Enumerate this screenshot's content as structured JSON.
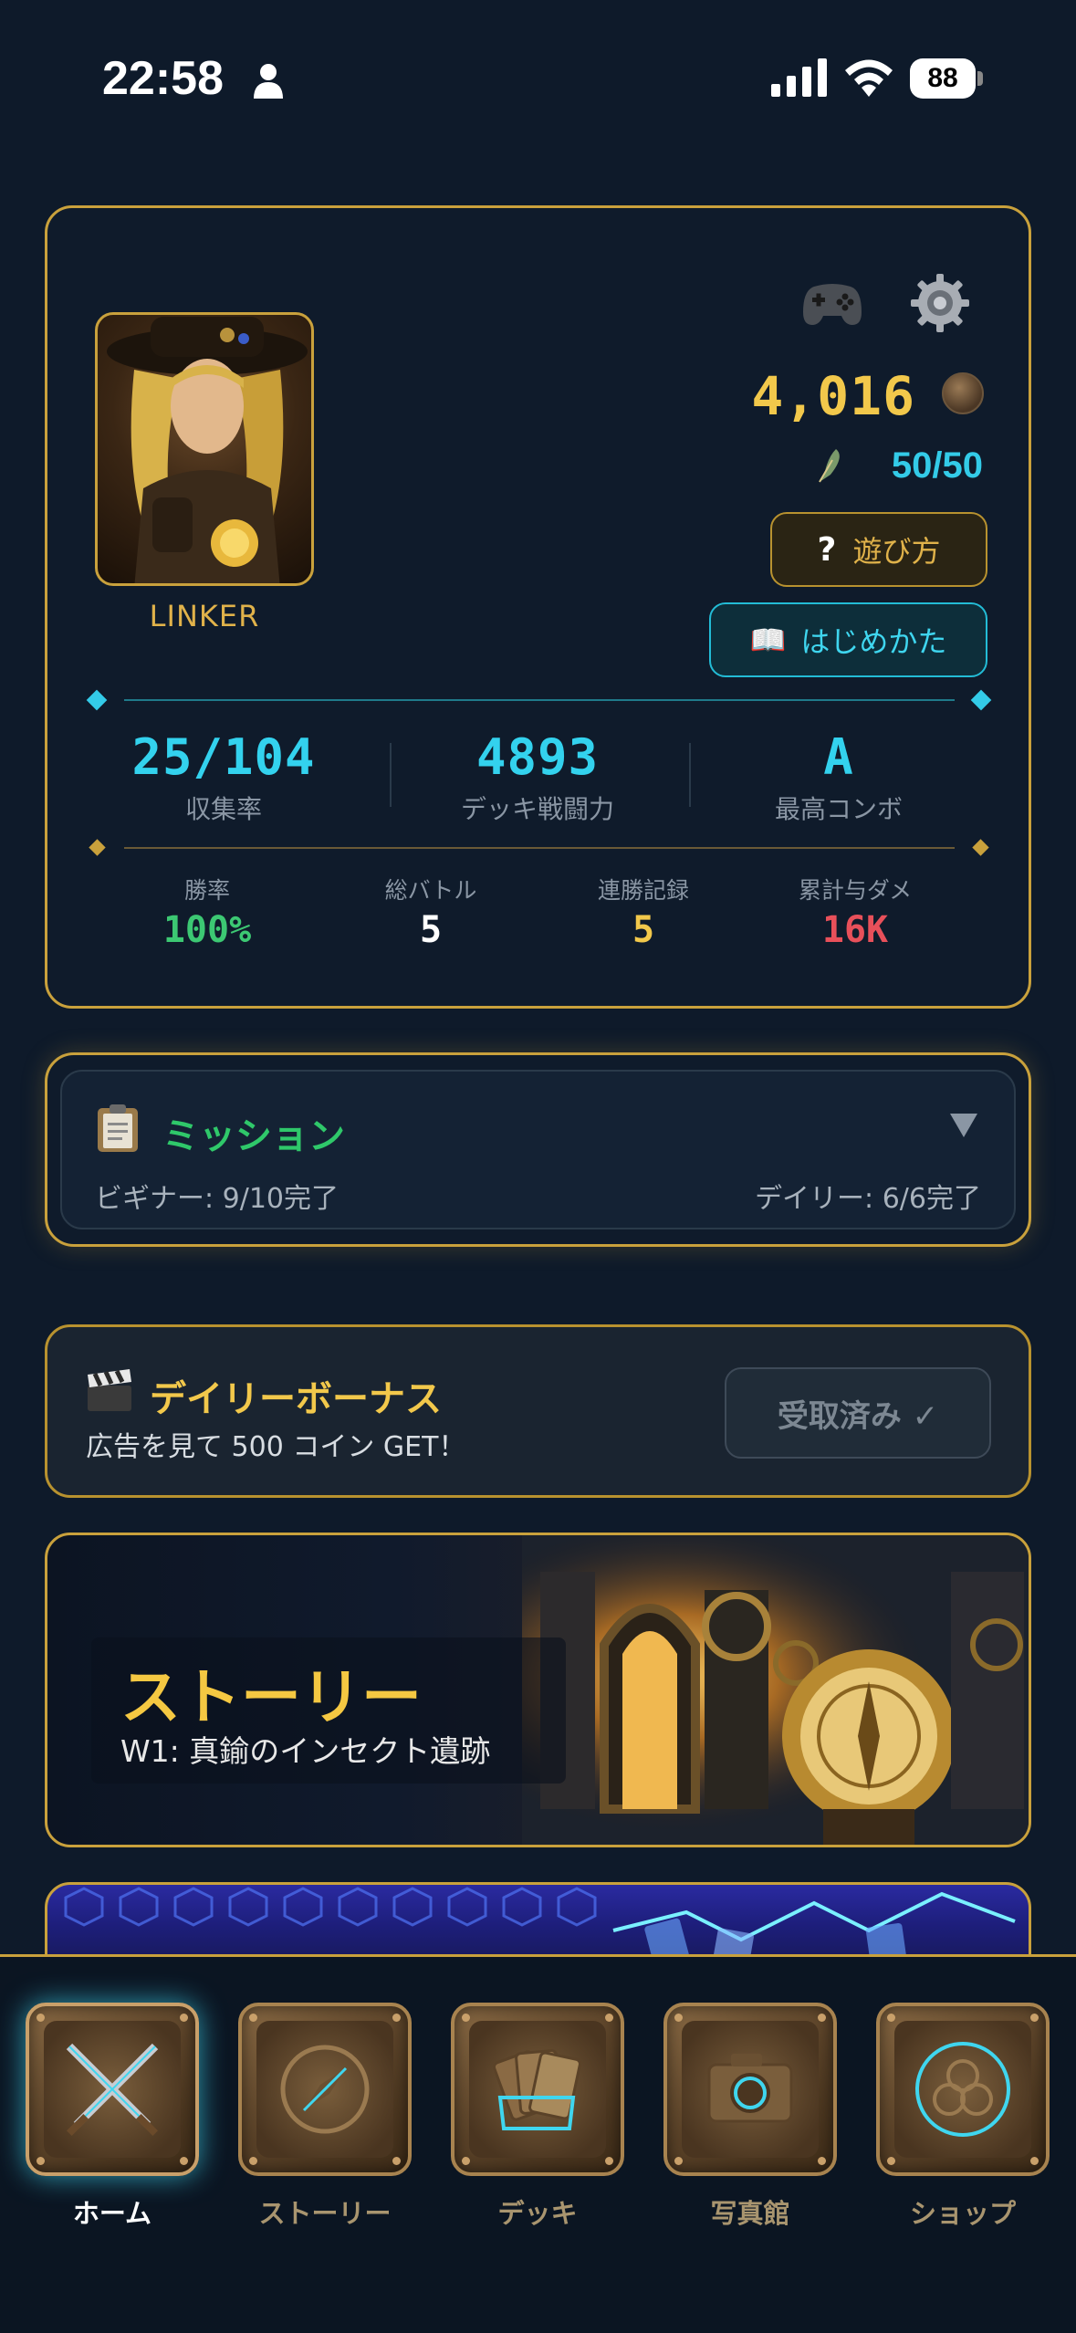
{
  "status_bar": {
    "time": "22:58",
    "battery": "88"
  },
  "profile": {
    "name": "LINKER",
    "coins": "4,016",
    "stamina": "50/50",
    "howto_label": "遊び方",
    "howto_prefix": "?",
    "start_label": "はじめかた",
    "stats_main": [
      {
        "value": "25/104",
        "label": "収集率"
      },
      {
        "value": "4893",
        "label": "デッキ戦闘力"
      },
      {
        "value": "A",
        "label": "最高コンボ"
      }
    ],
    "stats_sub": [
      {
        "label": "勝率",
        "value": "100%",
        "color": "#3cc873"
      },
      {
        "label": "総バトル",
        "value": "5",
        "color": "#ffffff"
      },
      {
        "label": "連勝記録",
        "value": "5",
        "color": "#f2c84b"
      },
      {
        "label": "累計与ダメ",
        "value": "16K",
        "color": "#e8505a"
      }
    ]
  },
  "mission": {
    "title": "ミッション",
    "beginner": "ビギナー: 9/10完了",
    "daily": "デイリー: 6/6完了"
  },
  "daily_bonus": {
    "title": "デイリーボーナス",
    "subtitle": "広告を見て 500 コイン GET！",
    "button_label": "受取済み ✓"
  },
  "story": {
    "title": "ストーリー",
    "subtitle": "W1: 真鍮のインセクト遺跡"
  },
  "tabs": [
    {
      "label": "ホーム",
      "icon": "crossed-swords-icon",
      "active": true
    },
    {
      "label": "ストーリー",
      "icon": "compass-icon",
      "active": false
    },
    {
      "label": "デッキ",
      "icon": "cards-icon",
      "active": false
    },
    {
      "label": "写真館",
      "icon": "camera-icon",
      "active": false
    },
    {
      "label": "ショップ",
      "icon": "ornament-icon",
      "active": false
    }
  ],
  "colors": {
    "gold": "#c9a13c",
    "cyan": "#33cbe8",
    "background": "#0e1a2a",
    "mission_green": "#2fc86a"
  }
}
